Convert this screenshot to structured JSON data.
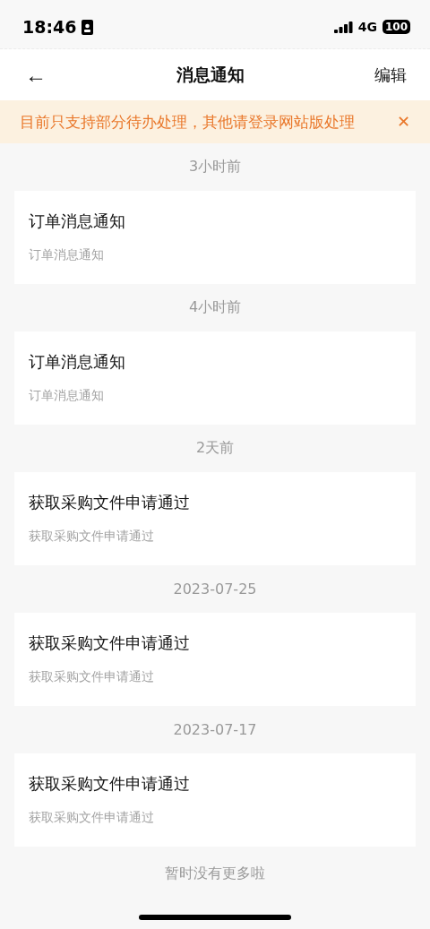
{
  "status_bar": {
    "time": "18:46",
    "network": "4G",
    "battery": "100"
  },
  "header": {
    "back": "←",
    "title": "消息通知",
    "action": "编辑"
  },
  "notice": {
    "text": "目前只支持部分待办处理，其他请登录网站版处理",
    "close": "✕"
  },
  "groups": [
    {
      "time": "3小时前",
      "title": "订单消息通知",
      "subtitle": "订单消息通知"
    },
    {
      "time": "4小时前",
      "title": "订单消息通知",
      "subtitle": "订单消息通知"
    },
    {
      "time": "2天前",
      "title": "获取采购文件申请通过",
      "subtitle": "获取采购文件申请通过"
    },
    {
      "time": "2023-07-25",
      "title": "获取采购文件申请通过",
      "subtitle": "获取采购文件申请通过"
    },
    {
      "time": "2023-07-17",
      "title": "获取采购文件申请通过",
      "subtitle": "获取采购文件申请通过"
    }
  ],
  "footer": "暂时没有更多啦"
}
